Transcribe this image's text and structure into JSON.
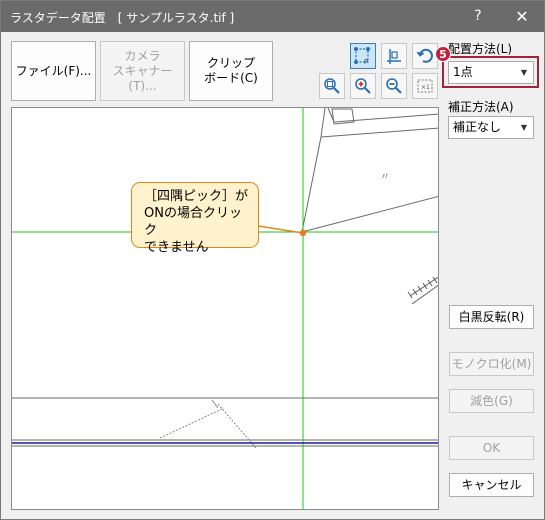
{
  "window": {
    "title": "ラスタデータ配置　[ サンプルラスタ.tif ]",
    "help_label": "?",
    "close_label": "✕"
  },
  "toolbar": {
    "file_label": "ファイル(F)...",
    "camera_line1": "カメラ",
    "camera_line2": "スキャナー(T)...",
    "clipboard_line1": "クリップ",
    "clipboard_line2": "ボード(C)"
  },
  "callout": {
    "line1": "［四隅ピック］が",
    "line2": "ONの場合クリック",
    "line3": "できません"
  },
  "placement": {
    "label": "配置方法(L)",
    "value": "1点",
    "badge": "5"
  },
  "correction": {
    "label": "補正方法(A)",
    "value": "補正なし"
  },
  "buttons": {
    "invert": "白黒反転(R)",
    "mono": "モノクロ化(M)",
    "reduce": "減色(G)",
    "ok": "OK",
    "cancel": "キャンセル"
  },
  "drawing": {
    "mark": "〃"
  },
  "colors": {
    "titlebar": "#6b6b6b",
    "highlight": "#a2243a",
    "callout_fill": "#fff2cc",
    "callout_border": "#e0861d",
    "crosshair": "#22c322",
    "blue_line": "#1a1aa6"
  }
}
